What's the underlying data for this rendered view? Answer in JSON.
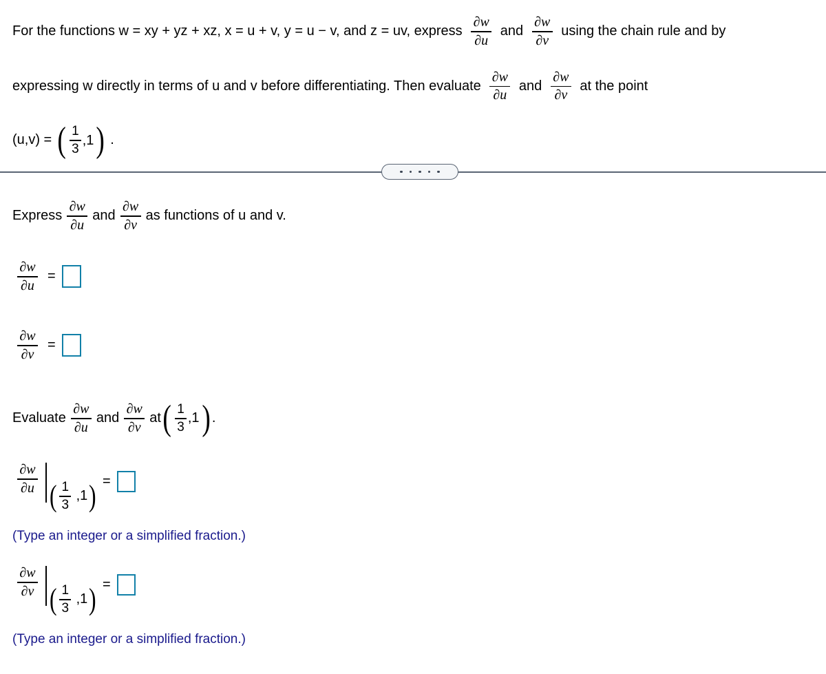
{
  "problem": {
    "line1_a": "For the functions w = xy + yz + xz, x = u + v, y = u − v, and z = uv, express",
    "line1_and": "and",
    "line1_b": "using the chain rule and by",
    "line2_a": "expressing w directly in terms of u and v before differentiating. Then evaluate",
    "line2_and": "and",
    "line2_b": "at the point",
    "line3_label": "(u,v) =",
    "line3_period": "."
  },
  "math": {
    "partial": "∂",
    "w": "w",
    "du": "∂u",
    "dv": "∂v",
    "dw": "∂w",
    "equals": "=",
    "comma_one": ",1",
    "frac_num": "1",
    "frac_den": "3",
    "paren_open": "(",
    "paren_close": ")"
  },
  "divider": {
    "dots": [
      "•",
      "•",
      "•",
      "•",
      "•"
    ]
  },
  "sections": {
    "express": {
      "lead": "Express",
      "and": "and",
      "tail": "as functions of u and v."
    },
    "answer_u": {
      "equals": "=",
      "value": ""
    },
    "answer_v": {
      "equals": "=",
      "value": ""
    },
    "evaluate": {
      "lead": "Evaluate",
      "and": "and",
      "at": "at",
      "period": "."
    },
    "eval_u": {
      "equals": "=",
      "value": "",
      "note": "(Type an integer or a simplified fraction.)"
    },
    "eval_v": {
      "equals": "=",
      "value": "",
      "note": "(Type an integer or a simplified fraction.)"
    }
  },
  "colors": {
    "answer_box_border": "#1180a8",
    "note_text": "#1a1a8c",
    "divider_line": "#5a6473",
    "text": "#000000",
    "background": "#ffffff"
  }
}
